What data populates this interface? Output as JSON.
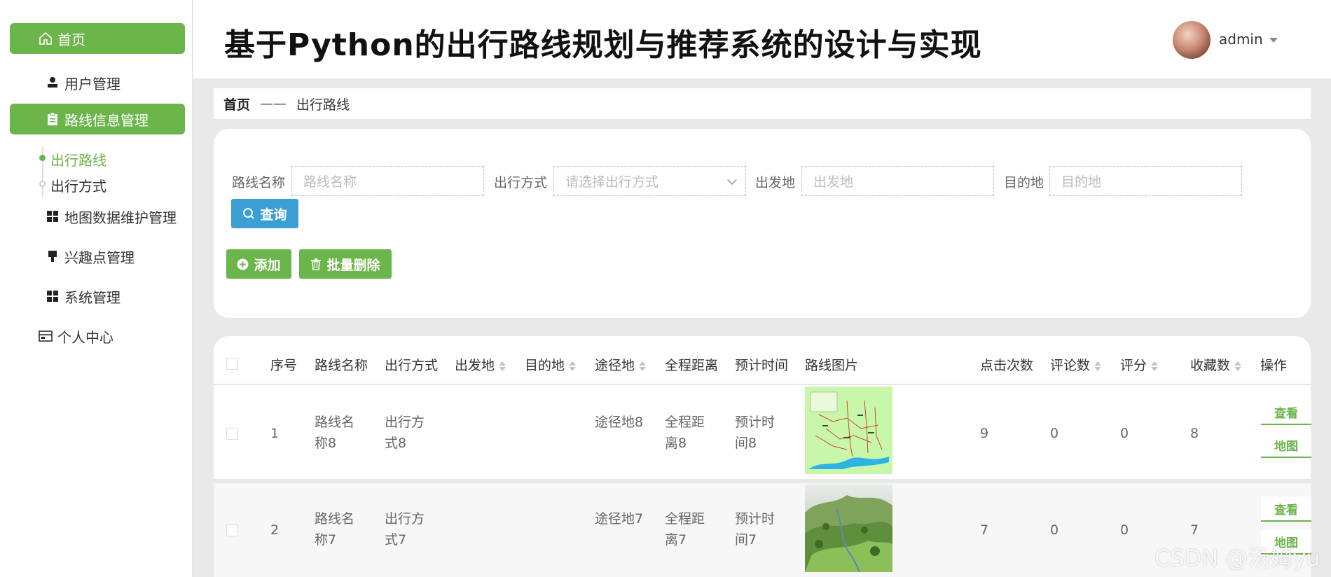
{
  "sidebar": {
    "items": [
      {
        "label": "首页",
        "icon": "home-icon"
      },
      {
        "label": "用户管理",
        "icon": "user-icon"
      },
      {
        "label": "路线信息管理",
        "icon": "clipboard-icon"
      },
      {
        "label": "地图数据维护管理",
        "icon": "grid-icon"
      },
      {
        "label": "兴趣点管理",
        "icon": "pin-icon"
      },
      {
        "label": "系统管理",
        "icon": "grid-icon"
      },
      {
        "label": "个人中心",
        "icon": "card-icon"
      }
    ],
    "sub_items": [
      {
        "label": "出行路线",
        "active": true
      },
      {
        "label": "出行方式",
        "active": false
      }
    ]
  },
  "header": {
    "title": "基于Python的出行路线规划与推荐系统的设计与实现",
    "user": "admin"
  },
  "breadcrumb": {
    "home": "首页",
    "separator": "——",
    "current": "出行路线"
  },
  "search": {
    "fields": [
      {
        "label": "路线名称",
        "placeholder": "路线名称"
      },
      {
        "label": "出行方式",
        "placeholder": "请选择出行方式"
      },
      {
        "label": "出发地",
        "placeholder": "出发地"
      },
      {
        "label": "目的地",
        "placeholder": "目的地"
      }
    ],
    "query_label": "查询",
    "add_label": "添加",
    "batch_delete_label": "批量删除"
  },
  "table": {
    "columns": [
      "序号",
      "路线名称",
      "出行方式",
      "出发地",
      "目的地",
      "途径地",
      "全程距离",
      "预计时间",
      "路线图片",
      "点击次数",
      "评论数",
      "评分",
      "收藏数",
      "操作"
    ],
    "rows": [
      {
        "index": "1",
        "name": "路线名称8",
        "mode": "出行方式8",
        "start": "",
        "end": "",
        "via": "途径地8",
        "distance": "全程距离8",
        "time": "预计时间8",
        "image": "route-map-image",
        "clicks": "9",
        "comments": "0",
        "rating": "0",
        "favorites": "8",
        "actions": [
          "查看",
          "地图"
        ]
      },
      {
        "index": "2",
        "name": "路线名称7",
        "mode": "出行方式7",
        "start": "",
        "end": "",
        "via": "途径地7",
        "distance": "全程距离7",
        "time": "预计时间7",
        "image": "landscape-image",
        "clicks": "7",
        "comments": "0",
        "rating": "0",
        "favorites": "7",
        "actions": [
          "查看",
          "地图"
        ]
      }
    ]
  },
  "colors": {
    "accent": "#6bb54a",
    "query": "#3b9fd3"
  },
  "watermark": "CSDN @汤姆yu"
}
